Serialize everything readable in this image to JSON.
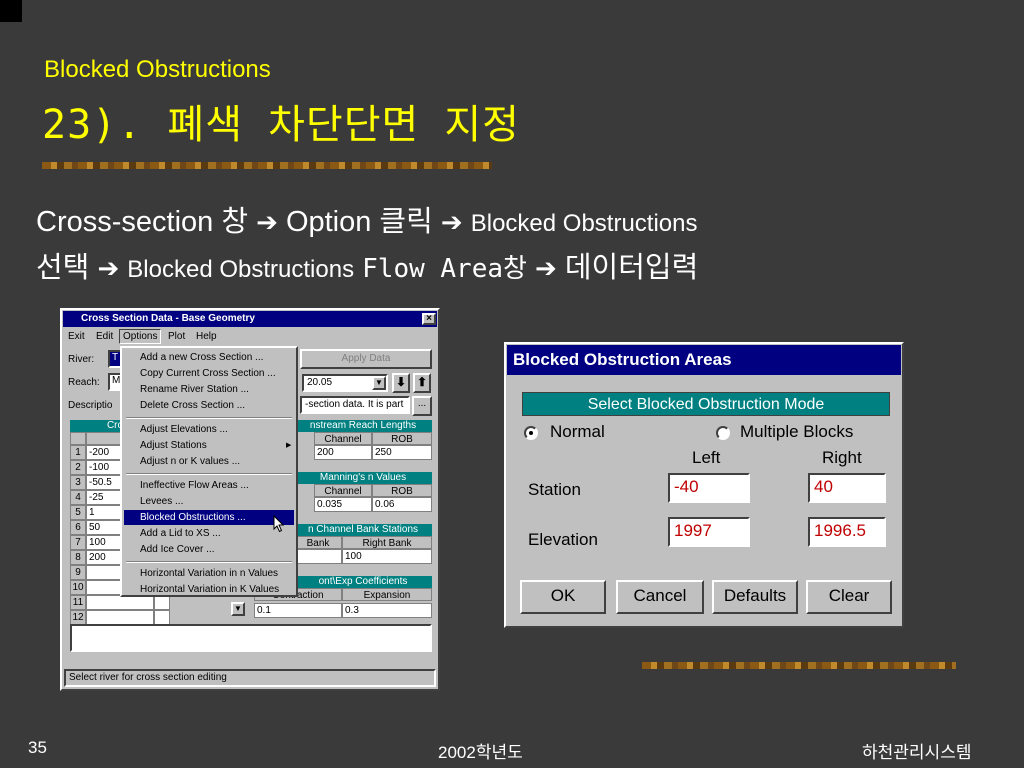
{
  "slide": {
    "subtitle": "Blocked Obstructions",
    "title": "23). 폐색 차단단면 지정",
    "line1": {
      "a": "Cross-section 창",
      "b": "Option 클릭",
      "c": "Blocked Obstructions"
    },
    "line2": {
      "a": "선택",
      "b": "Blocked Obstructions",
      "c": "Flow Area창",
      "d": "데이터입력"
    },
    "arrow": "➔",
    "footer": {
      "page": "35",
      "year": "2002학년도",
      "org": "하천관리시스템"
    }
  },
  "cross_section_window": {
    "title": "Cross Section Data - Base Geometry",
    "close": "×",
    "menu": [
      "Exit",
      "Edit",
      "Options",
      "Plot",
      "Help"
    ],
    "river_label": "River:",
    "river_value": "T",
    "reach_label": "Reach:",
    "reach_value": "M",
    "description_label": "Descriptio",
    "apply_button": "Apply Data",
    "station_value": "20.05",
    "description_value": "-section data.  It is part",
    "ellipsis_button": "...",
    "cross_header": "Cross",
    "s_header": "S",
    "rows": [
      {
        "n": "1",
        "v": "-200"
      },
      {
        "n": "2",
        "v": "-100"
      },
      {
        "n": "3",
        "v": "-50.5"
      },
      {
        "n": "4",
        "v": "-25"
      },
      {
        "n": "5",
        "v": "1"
      },
      {
        "n": "6",
        "v": "50"
      },
      {
        "n": "7",
        "v": "100"
      },
      {
        "n": "8",
        "v": "200"
      },
      {
        "n": "9",
        "v": ""
      },
      {
        "n": "10",
        "v": ""
      },
      {
        "n": "11",
        "v": ""
      },
      {
        "n": "12",
        "v": ""
      }
    ],
    "downstream": {
      "header": "nstream Reach Lengths",
      "cols": [
        "Channel",
        "ROB"
      ],
      "vals": [
        "200",
        "250"
      ]
    },
    "mannings": {
      "header": "Manning's n Values",
      "cols": [
        "Channel",
        "ROB"
      ],
      "vals": [
        "0.035",
        "0.06"
      ]
    },
    "bank": {
      "header": "n Channel Bank Stations",
      "cols": [
        "Bank",
        "Right Bank"
      ],
      "vals": [
        "100"
      ]
    },
    "coeff": {
      "header": "ont\\Exp  Coefficients",
      "cols": [
        "Contraction",
        "Expansion"
      ],
      "vals": [
        "0.1",
        "0.3"
      ]
    },
    "status": "Select river for cross section editing",
    "options_menu": [
      "Add a new Cross Section ...",
      "Copy Current Cross Section ...",
      "Rename River Station ...",
      "Delete Cross Section ...",
      "Adjust Elevations ...",
      "Adjust Stations",
      "Adjust n or K values ...",
      "Ineffective Flow Areas ...",
      "Levees ...",
      "Blocked Obstructions ...",
      "Add a Lid to XS ...",
      "Add Ice Cover ...",
      "Horizontal Variation in n Values",
      "Horizontal Variation in K Values"
    ],
    "submenu_arrow": "▶"
  },
  "blocked_dialog": {
    "title": "Blocked Obstruction Areas",
    "mode_header": "Select Blocked Obstruction Mode",
    "normal": "Normal",
    "multiple": "Multiple Blocks",
    "left": "Left",
    "right": "Right",
    "station_label": "Station",
    "elevation_label": "Elevation",
    "station_left": "-40",
    "station_right": "40",
    "elevation_left": "1997",
    "elevation_right": "1996.5",
    "buttons": {
      "ok": "OK",
      "cancel": "Cancel",
      "defaults": "Defaults",
      "clear": "Clear"
    }
  },
  "colors": {
    "title": "#ffff00",
    "background": "#3a3a3a",
    "titlebar": "#000080",
    "teal": "#008080",
    "input_text": "#c00000"
  }
}
